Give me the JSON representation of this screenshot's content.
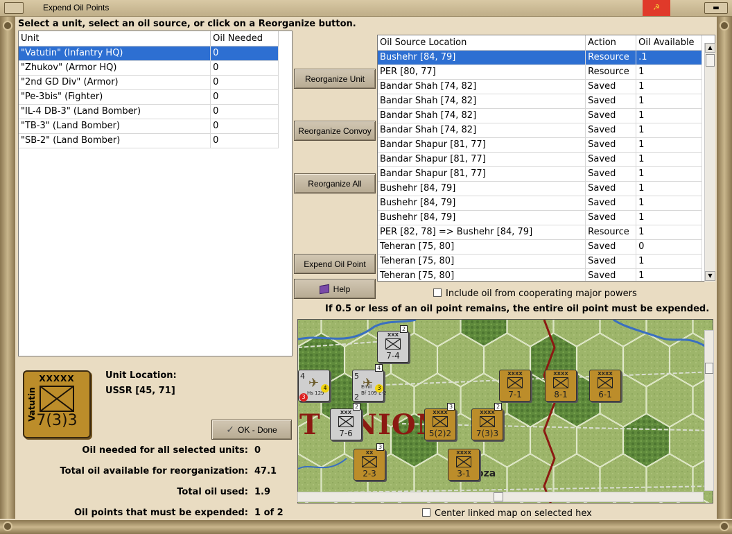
{
  "window": {
    "title": "Expend Oil Points"
  },
  "instructions": "Select a unit, select an oil source, or click on a Reorganize button.",
  "unit_table": {
    "columns": [
      "Unit",
      "Oil Needed"
    ],
    "rows": [
      {
        "unit": "\"Vatutin\" (Infantry HQ)",
        "oil": "0"
      },
      {
        "unit": "\"Zhukov\" (Armor HQ)",
        "oil": "0"
      },
      {
        "unit": "\"2nd GD Div\" (Armor)",
        "oil": "0"
      },
      {
        "unit": "\"Pe-3bis\" (Fighter)",
        "oil": "0"
      },
      {
        "unit": "\"IL-4 DB-3\" (Land Bomber)",
        "oil": "0"
      },
      {
        "unit": "\"TB-3\" (Land Bomber)",
        "oil": "0"
      },
      {
        "unit": "\"SB-2\" (Land Bomber)",
        "oil": "0"
      }
    ]
  },
  "buttons": {
    "reorganize_unit": "Reorganize Unit",
    "reorganize_convoy": "Reorganize Convoy",
    "reorganize_all": "Reorganize All",
    "expend_oil_point": "Expend Oil Point",
    "help": "Help",
    "ok_done": "OK - Done"
  },
  "oil_table": {
    "columns": [
      "Oil Source Location",
      "Action",
      "Oil Available"
    ],
    "rows": [
      {
        "loc": "Bushehr [84, 79]",
        "action": "Resource",
        "avail": ".1"
      },
      {
        "loc": "PER [80, 77]",
        "action": "Resource",
        "avail": "1"
      },
      {
        "loc": "Bandar Shah [74, 82]",
        "action": "Saved",
        "avail": "1"
      },
      {
        "loc": "Bandar Shah [74, 82]",
        "action": "Saved",
        "avail": "1"
      },
      {
        "loc": "Bandar Shah [74, 82]",
        "action": "Saved",
        "avail": "1"
      },
      {
        "loc": "Bandar Shah [74, 82]",
        "action": "Saved",
        "avail": "1"
      },
      {
        "loc": "Bandar Shapur [81, 77]",
        "action": "Saved",
        "avail": "1"
      },
      {
        "loc": "Bandar Shapur [81, 77]",
        "action": "Saved",
        "avail": "1"
      },
      {
        "loc": "Bandar Shapur [81, 77]",
        "action": "Saved",
        "avail": "1"
      },
      {
        "loc": "Bushehr [84, 79]",
        "action": "Saved",
        "avail": "1"
      },
      {
        "loc": "Bushehr [84, 79]",
        "action": "Saved",
        "avail": "1"
      },
      {
        "loc": "Bushehr [84, 79]",
        "action": "Saved",
        "avail": "1"
      },
      {
        "loc": "PER [82, 78] => Bushehr [84, 79]",
        "action": "Resource",
        "avail": "1"
      },
      {
        "loc": "Teheran [75, 80]",
        "action": "Saved",
        "avail": "0"
      },
      {
        "loc": "Teheran [75, 80]",
        "action": "Saved",
        "avail": "1"
      },
      {
        "loc": "Teheran [75, 80]",
        "action": "Saved",
        "avail": "1"
      }
    ]
  },
  "include_coop_label": "Include oil from cooperating major powers",
  "rule_note": "If 0.5 or less of an oil point remains, the entire oil point must be expended.",
  "counter": {
    "size": "XXXXX",
    "name": "Vatutin",
    "strength": "7(3)3"
  },
  "location": {
    "label": "Unit Location:",
    "value": "USSR [45, 71]"
  },
  "stats": {
    "oil_needed_label": "Oil needed for all selected units:",
    "oil_needed_value": "0",
    "total_available_label": "Total oil available for reorganization:",
    "total_available_value": "47.1",
    "total_used_label": "Total oil used:",
    "total_used_value": "1.9",
    "must_expend_label": "Oil points that must be expended:",
    "must_expend_value": "1 of 2"
  },
  "center_map_label": "Center linked map on selected hex",
  "map": {
    "region_text": "T   NION",
    "place_text": "oza",
    "units": [
      {
        "id": "xxx-top",
        "size": "XXX",
        "value": "7-4",
        "stack": "2"
      },
      {
        "id": "air-hs129",
        "value": "4",
        "extra": "Hs 129",
        "badge_red": "3",
        "badge_yellow": "4"
      },
      {
        "id": "air-bf109",
        "value": "5",
        "extra": "Bf 109 E-2",
        "sub": "Emil",
        "num2": "2",
        "badge_yellow": "3",
        "stack": "4"
      },
      {
        "id": "xxxx-71",
        "size": "XXXX",
        "value": "7-1"
      },
      {
        "id": "xxxx-81",
        "size": "XXXX",
        "value": "8-1"
      },
      {
        "id": "xxxx-61",
        "size": "XXXX",
        "value": "6-1"
      },
      {
        "id": "xxx-76",
        "size": "XXX",
        "value": "7-6",
        "stack": "2"
      },
      {
        "id": "xxxx-522",
        "size": "XXXX",
        "value": "5(2)2",
        "stack": "3"
      },
      {
        "id": "xxxx-733",
        "size": "XXXX",
        "value": "7(3)3",
        "stack": "2"
      },
      {
        "id": "xx-23",
        "size": "XX",
        "value": "2-3",
        "stack": "3"
      },
      {
        "id": "xxxx-31",
        "size": "XXXX",
        "value": "3-1"
      }
    ]
  },
  "colors": {
    "selection": "#2d6fd2",
    "counter_brown": "#bc8d2a",
    "german_grey": "#b8b8b8",
    "region_text": "#8b1a12",
    "border_red": "#8b1a12",
    "river": "#3a6fc0"
  }
}
